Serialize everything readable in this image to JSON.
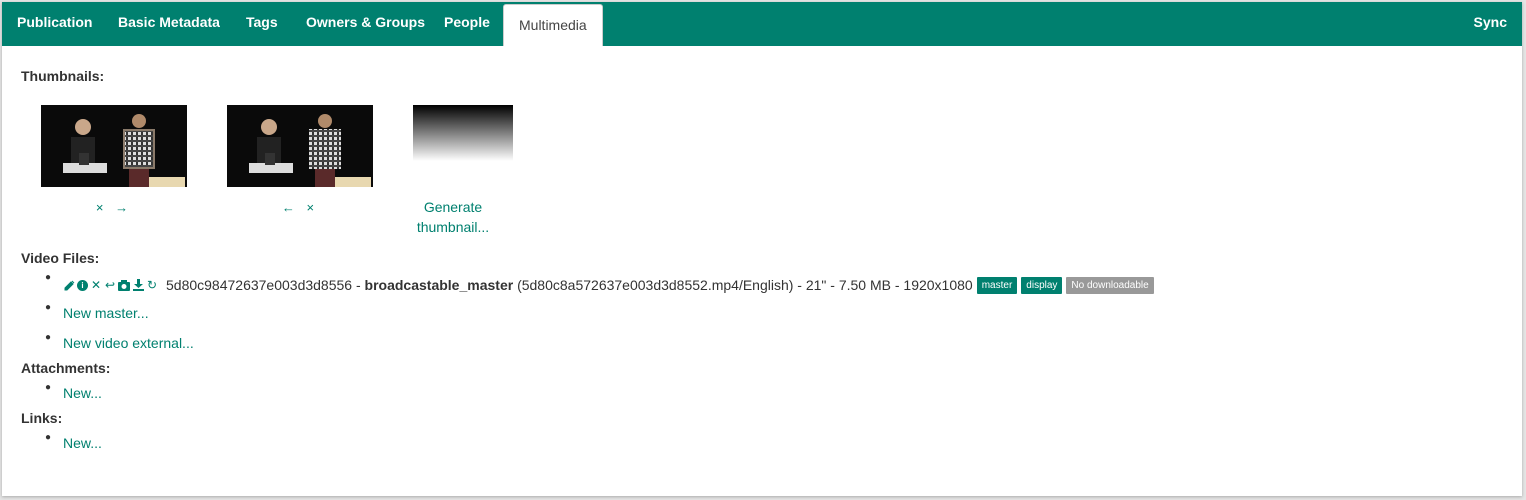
{
  "tabs": [
    {
      "label": "Publication"
    },
    {
      "label": "Basic Metadata"
    },
    {
      "label": "Tags"
    },
    {
      "label": "Owners & Groups"
    },
    {
      "label": "People"
    },
    {
      "label": "Multimedia",
      "active": true
    }
  ],
  "sync_label": "Sync",
  "sections": {
    "thumbnails": "Thumbnails:",
    "video_files": "Video Files:",
    "attachments": "Attachments:",
    "links": "Links:"
  },
  "thumbnails": [
    {
      "actions": [
        "×",
        "→"
      ],
      "icons": [
        "remove-icon",
        "arrow-right-icon"
      ]
    },
    {
      "actions": [
        "←",
        "×"
      ],
      "icons": [
        "arrow-left-icon",
        "remove-icon"
      ]
    }
  ],
  "generate_thumbnail": {
    "label": "Generate thumbnail..."
  },
  "video": {
    "id": "5d80c98472637e003d3d8556",
    "separator1": " - ",
    "name": "broadcastable_master",
    "details": " (5d80c8a572637e003d3d8552.mp4/English) - 21\" - 7.50 MB - 1920x1080",
    "icons": [
      "edit-icon",
      "info-icon",
      "delete-icon",
      "undo-icon",
      "camera-icon",
      "download-icon",
      "refresh-icon"
    ],
    "badges": [
      {
        "label": "master",
        "color": "#00806f"
      },
      {
        "label": "display",
        "color": "#00806f"
      },
      {
        "label": "No downloadable",
        "color": "#999999"
      }
    ]
  },
  "video_links": {
    "new_master": "New master...",
    "new_external": "New video external..."
  },
  "attachments_new": "New...",
  "links_new": "New...",
  "colors": {
    "accent": "#00806f",
    "badge_grey": "#999999"
  }
}
